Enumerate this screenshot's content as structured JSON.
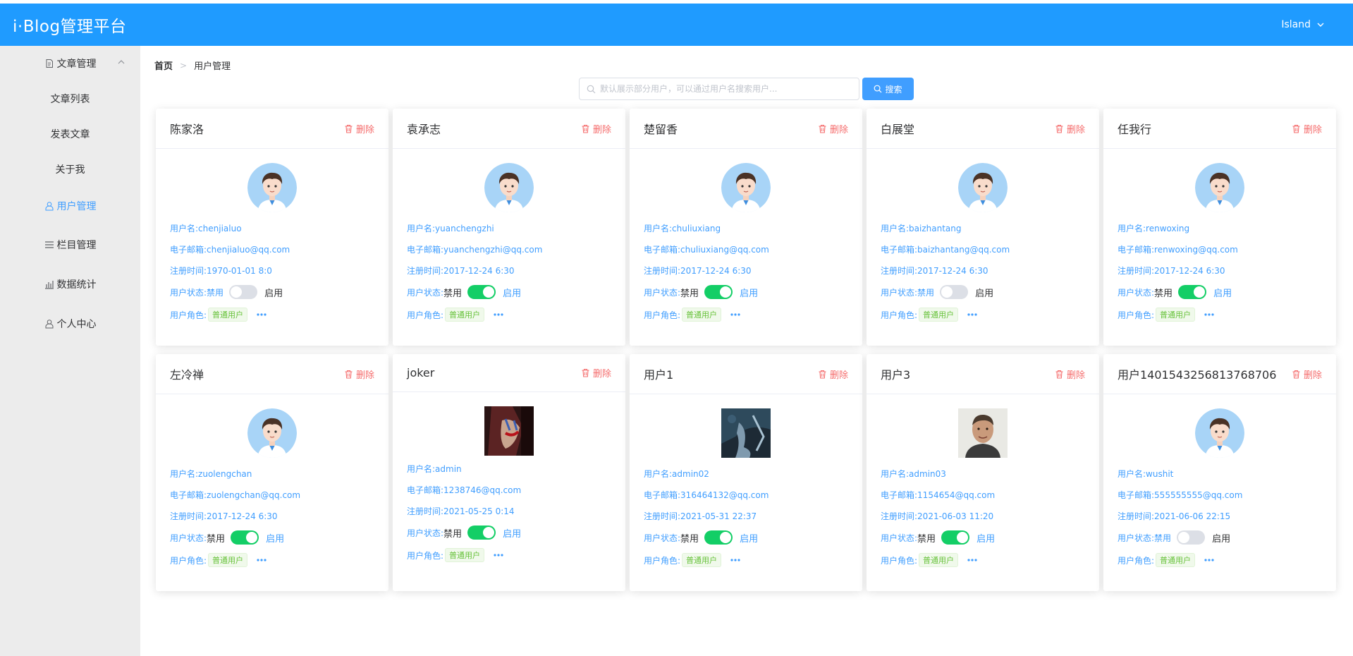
{
  "header": {
    "brand": "i·Blog管理平台",
    "user": "Island"
  },
  "sidebar": {
    "items": [
      {
        "label": "文章管理",
        "icon": "document-icon"
      },
      {
        "label": "文章列表"
      },
      {
        "label": "发表文章"
      },
      {
        "label": "关于我"
      },
      {
        "label": "用户管理",
        "icon": "user-icon"
      },
      {
        "label": "栏目管理",
        "icon": "menu-icon"
      },
      {
        "label": "数据统计",
        "icon": "bar-chart-icon"
      },
      {
        "label": "个人中心",
        "icon": "user-icon"
      }
    ]
  },
  "breadcrumb": {
    "home": "首页",
    "current": "用户管理"
  },
  "search": {
    "placeholder": "默认展示部分用户，可以通过用户名搜索用户...",
    "button": "搜索"
  },
  "labels": {
    "delete": "删除",
    "username": "用户名:",
    "email": "电子邮箱:",
    "registered": "注册时间:",
    "status": "用户状态:",
    "disabled": "禁用",
    "enabled": "启用",
    "role": "用户角色:",
    "role_value": "普通用户"
  },
  "users": [
    {
      "name": "陈家洛",
      "username": "chenjialuo",
      "email": "chenjialuo@qq.com",
      "registered": "1970-01-01 8:0",
      "enabled": false,
      "avatar": "cartoon"
    },
    {
      "name": "袁承志",
      "username": "yuanchengzhi",
      "email": "yuanchengzhi@qq.com",
      "registered": "2017-12-24 6:30",
      "enabled": true,
      "avatar": "cartoon"
    },
    {
      "name": "楚留香",
      "username": "chuliuxiang",
      "email": "chuliuxiang@qq.com",
      "registered": "2017-12-24 6:30",
      "enabled": true,
      "avatar": "cartoon"
    },
    {
      "name": "白展堂",
      "username": "baizhantang",
      "email": "baizhantang@qq.com",
      "registered": "2017-12-24 6:30",
      "enabled": false,
      "avatar": "cartoon"
    },
    {
      "name": "任我行",
      "username": "renwoxing",
      "email": "renwoxing@qq.com",
      "registered": "2017-12-24 6:30",
      "enabled": true,
      "avatar": "cartoon"
    },
    {
      "name": "左冷禅",
      "username": "zuolengchan",
      "email": "zuolengchan@qq.com",
      "registered": "2017-12-24 6:30",
      "enabled": true,
      "avatar": "cartoon"
    },
    {
      "name": "joker",
      "username": "admin",
      "email": "1238746@qq.com",
      "registered": "2021-05-25 0:14",
      "enabled": true,
      "avatar": "photo-joker"
    },
    {
      "name": "用户1",
      "username": "admin02",
      "email": "316464132@qq.com",
      "registered": "2021-05-31 22:37",
      "enabled": true,
      "avatar": "photo-dark"
    },
    {
      "name": "用户3",
      "username": "admin03",
      "email": "1154654@qq.com",
      "registered": "2021-06-03 11:20",
      "enabled": true,
      "avatar": "photo-man"
    },
    {
      "name": "用户1401543256813768706",
      "username": "wushit",
      "email": "555555555@qq.com",
      "registered": "2021-06-06 22:15",
      "enabled": false,
      "avatar": "cartoon"
    }
  ]
}
